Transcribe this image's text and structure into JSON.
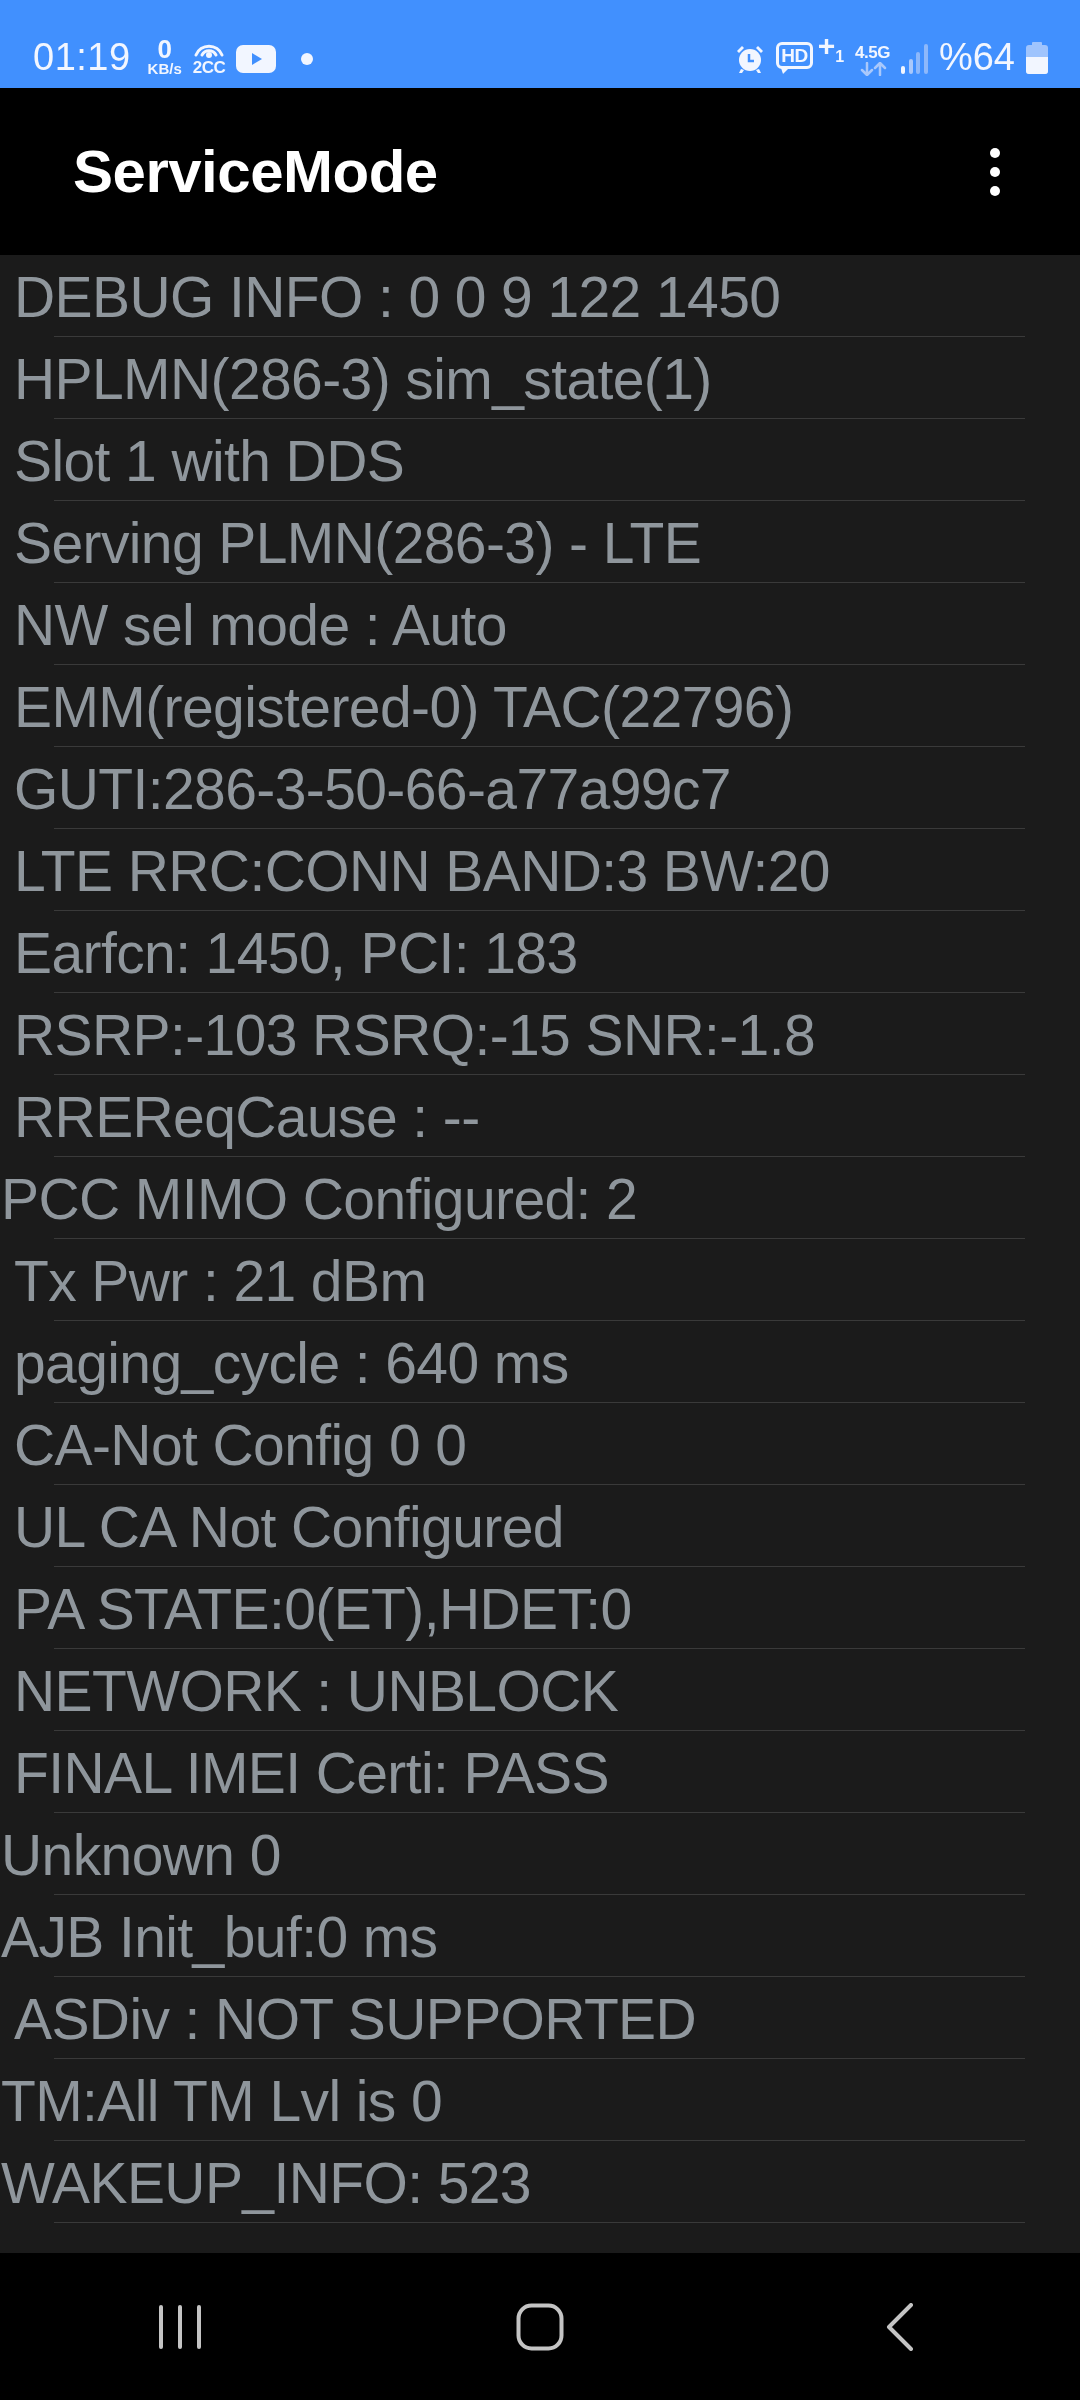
{
  "status_bar": {
    "time": "01:19",
    "data_speed": {
      "value": "0",
      "unit": "KB/s"
    },
    "hotspot_label": "2CC",
    "hd_voice": {
      "badge": "HD",
      "suffix": "+$_{1}$"
    },
    "network_type": "4.5G",
    "battery_percent": "%64"
  },
  "app_bar": {
    "title": "ServiceMode"
  },
  "info_lines": [
    {
      "text": "DEBUG INFO : 0 0 9 122 1450",
      "indented": true
    },
    {
      "text": "HPLMN(286-3) sim_state(1)",
      "indented": true
    },
    {
      "text": "Slot 1 with DDS",
      "indented": true
    },
    {
      "text": "Serving PLMN(286-3) - LTE",
      "indented": true
    },
    {
      "text": "NW sel mode : Auto",
      "indented": true
    },
    {
      "text": "EMM(registered-0) TAC(22796)",
      "indented": true
    },
    {
      "text": "GUTI:286-3-50-66-a77a99c7",
      "indented": true
    },
    {
      "text": "LTE RRC:CONN BAND:3 BW:20",
      "indented": true
    },
    {
      "text": "Earfcn: 1450, PCI: 183",
      "indented": true
    },
    {
      "text": "RSRP:-103 RSRQ:-15 SNR:-1.8",
      "indented": true
    },
    {
      "text": "RREReqCause : --",
      "indented": true
    },
    {
      "text": "PCC MIMO Configured: 2",
      "indented": false
    },
    {
      "text": "Tx Pwr : 21 dBm",
      "indented": true
    },
    {
      "text": "paging_cycle : 640 ms",
      "indented": true
    },
    {
      "text": "CA-Not Config 0 0",
      "indented": true
    },
    {
      "text": "UL CA Not Configured",
      "indented": true
    },
    {
      "text": "PA STATE:0(ET),HDET:0",
      "indented": true
    },
    {
      "text": "NETWORK : UNBLOCK",
      "indented": true
    },
    {
      "text": "FINAL IMEI Certi: PASS",
      "indented": true
    },
    {
      "text": "Unknown 0",
      "indented": false
    },
    {
      "text": "AJB Init_buf:0 ms",
      "indented": false
    },
    {
      "text": "ASDiv : NOT SUPPORTED",
      "indented": true
    },
    {
      "text": "TM:All TM Lvl is 0",
      "indented": false
    },
    {
      "text": "WAKEUP_INFO: 523",
      "indented": false
    }
  ]
}
